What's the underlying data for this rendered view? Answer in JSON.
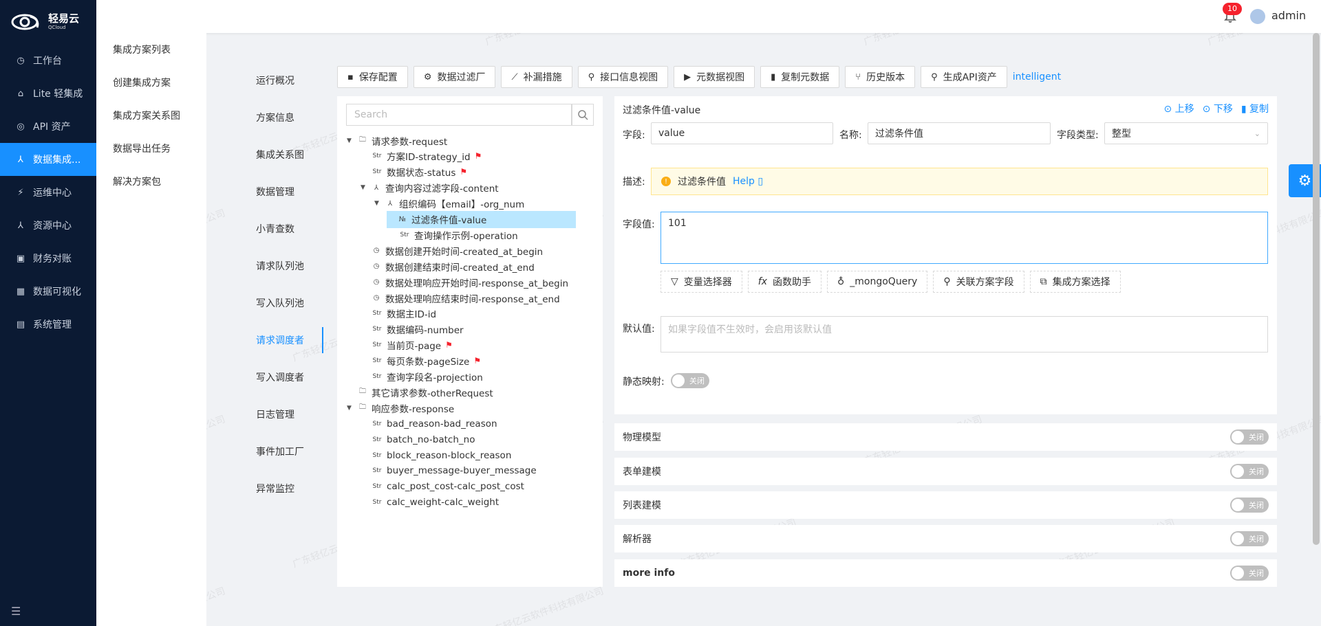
{
  "brand": {
    "name": "轻易云",
    "sub": "QCloud"
  },
  "sidenav": [
    {
      "icon": "clock-icon",
      "glyph": "◷",
      "label": "工作台",
      "active": false
    },
    {
      "icon": "lite-icon",
      "glyph": "⌂",
      "label": "Lite 轻集成",
      "active": false
    },
    {
      "icon": "compass-icon",
      "glyph": "◎",
      "label": "API 资产",
      "active": false
    },
    {
      "icon": "integration-icon",
      "glyph": "⅄",
      "label": "数据集成...",
      "active": true
    },
    {
      "icon": "ops-icon",
      "glyph": "⚡",
      "label": "运维中心",
      "active": false
    },
    {
      "icon": "resource-icon",
      "glyph": "⅄",
      "label": "资源中心",
      "active": false
    },
    {
      "icon": "finance-icon",
      "glyph": "▣",
      "label": "财务对账",
      "active": false
    },
    {
      "icon": "chart-icon",
      "glyph": "▦",
      "label": "数据可视化",
      "active": false
    },
    {
      "icon": "system-icon",
      "glyph": "▤",
      "label": "系统管理",
      "active": false
    }
  ],
  "subnav": [
    "集成方案列表",
    "创建集成方案",
    "集成方案关系图",
    "数据导出任务",
    "解决方案包"
  ],
  "header": {
    "badge_count": "10",
    "username": "admin"
  },
  "tabs3": [
    "运行概况",
    "方案信息",
    "集成关系图",
    "数据管理",
    "小青查数",
    "请求队列池",
    "写入队列池",
    "请求调度者",
    "写入调度者",
    "日志管理",
    "事件加工厂",
    "异常监控"
  ],
  "tabs3_active": 7,
  "toolbar": [
    {
      "icon": "save-icon",
      "glyph": "▪",
      "label": "保存配置"
    },
    {
      "icon": "filter-gear-icon",
      "glyph": "⚙",
      "label": "数据过滤厂"
    },
    {
      "icon": "remedy-icon",
      "glyph": "⟋",
      "label": "补漏措施"
    },
    {
      "icon": "link-icon",
      "glyph": "⚲",
      "label": "接口信息视图"
    },
    {
      "icon": "terminal-icon",
      "glyph": "▶",
      "label": "元数据视图"
    },
    {
      "icon": "copy-icon",
      "glyph": "▮",
      "label": "复制元数据"
    },
    {
      "icon": "branch-icon",
      "glyph": "⑂",
      "label": "历史版本"
    },
    {
      "icon": "api-link-icon",
      "glyph": "⚲",
      "label": "生成API资产"
    }
  ],
  "toolbar_link": "intelligent",
  "tree": {
    "search_placeholder": "Search",
    "nodes": [
      {
        "level": 0,
        "caret": "▼",
        "icon": "folder",
        "label": "请求参数-request",
        "flag": false
      },
      {
        "level": 1,
        "caret": "",
        "icon": "str",
        "label": "方案ID-strategy_id",
        "flag": true
      },
      {
        "level": 1,
        "caret": "",
        "icon": "str",
        "label": "数据状态-status",
        "flag": true
      },
      {
        "level": 1,
        "caret": "▼",
        "icon": "obj",
        "label": "查询内容过滤字段-content",
        "flag": false
      },
      {
        "level": 2,
        "caret": "▼",
        "icon": "obj",
        "label": "组织编码【email】-org_num",
        "flag": false
      },
      {
        "level": 3,
        "caret": "",
        "icon": "num",
        "label": "过滤条件值-value",
        "flag": false,
        "selected": true
      },
      {
        "level": 3,
        "caret": "",
        "icon": "str",
        "label": "查询操作示例-operation",
        "flag": false
      },
      {
        "level": 1,
        "caret": "",
        "icon": "time",
        "label": "数据创建开始时间-created_at_begin",
        "flag": false
      },
      {
        "level": 1,
        "caret": "",
        "icon": "time",
        "label": "数据创建结束时间-created_at_end",
        "flag": false
      },
      {
        "level": 1,
        "caret": "",
        "icon": "time",
        "label": "数据处理响应开始时间-response_at_begin",
        "flag": false
      },
      {
        "level": 1,
        "caret": "",
        "icon": "time",
        "label": "数据处理响应结束时间-response_at_end",
        "flag": false
      },
      {
        "level": 1,
        "caret": "",
        "icon": "str",
        "label": "数据主ID-id",
        "flag": false
      },
      {
        "level": 1,
        "caret": "",
        "icon": "str",
        "label": "数据编码-number",
        "flag": false
      },
      {
        "level": 1,
        "caret": "",
        "icon": "str",
        "label": "当前页-page",
        "flag": true
      },
      {
        "level": 1,
        "caret": "",
        "icon": "str",
        "label": "每页条数-pageSize",
        "flag": true
      },
      {
        "level": 1,
        "caret": "",
        "icon": "str",
        "label": "查询字段名-projection",
        "flag": false
      },
      {
        "level": 0,
        "caret": "",
        "icon": "folder",
        "label": "其它请求参数-otherRequest",
        "flag": false
      },
      {
        "level": 0,
        "caret": "▼",
        "icon": "folder",
        "label": "响应参数-response",
        "flag": false
      },
      {
        "level": 1,
        "caret": "",
        "icon": "str",
        "label": "bad_reason-bad_reason",
        "flag": false
      },
      {
        "level": 1,
        "caret": "",
        "icon": "str",
        "label": "batch_no-batch_no",
        "flag": false
      },
      {
        "level": 1,
        "caret": "",
        "icon": "str",
        "label": "block_reason-block_reason",
        "flag": false
      },
      {
        "level": 1,
        "caret": "",
        "icon": "str",
        "label": "buyer_message-buyer_message",
        "flag": false
      },
      {
        "level": 1,
        "caret": "",
        "icon": "str",
        "label": "calc_post_cost-calc_post_cost",
        "flag": false
      },
      {
        "level": 1,
        "caret": "",
        "icon": "str",
        "label": "calc_weight-calc_weight",
        "flag": false
      }
    ]
  },
  "form": {
    "title": "过滤条件值-value",
    "actions": {
      "up": "上移",
      "down": "下移",
      "copy": "复制"
    },
    "field_label": "字段:",
    "field_value": "value",
    "name_label": "名称:",
    "name_value": "过滤条件值",
    "type_label": "字段类型:",
    "type_value": "整型",
    "desc_label": "描述:",
    "desc_text": "过滤条件值",
    "desc_help": "Help",
    "value_label": "字段值:",
    "value_text": "101",
    "buttons": [
      {
        "icon": "filter-icon",
        "glyph": "▽",
        "label": "变量选择器"
      },
      {
        "icon": "function-icon",
        "glyph": "fx",
        "label": "函数助手"
      },
      {
        "icon": "bulb-icon",
        "glyph": "♁",
        "label": "_mongoQuery"
      },
      {
        "icon": "link-icon",
        "glyph": "⚲",
        "label": "关联方案字段"
      },
      {
        "icon": "api-icon",
        "glyph": "⧉",
        "label": "集成方案选择"
      }
    ],
    "default_label": "默认值:",
    "default_placeholder": "如果字段值不生效时，会启用该默认值",
    "static_label": "静态映射:",
    "switch_off": "关闭"
  },
  "sections": [
    "物理模型",
    "表单建模",
    "列表建模",
    "解析器",
    "more info"
  ],
  "watermark": "广东轻亿云软件科技有限公司"
}
